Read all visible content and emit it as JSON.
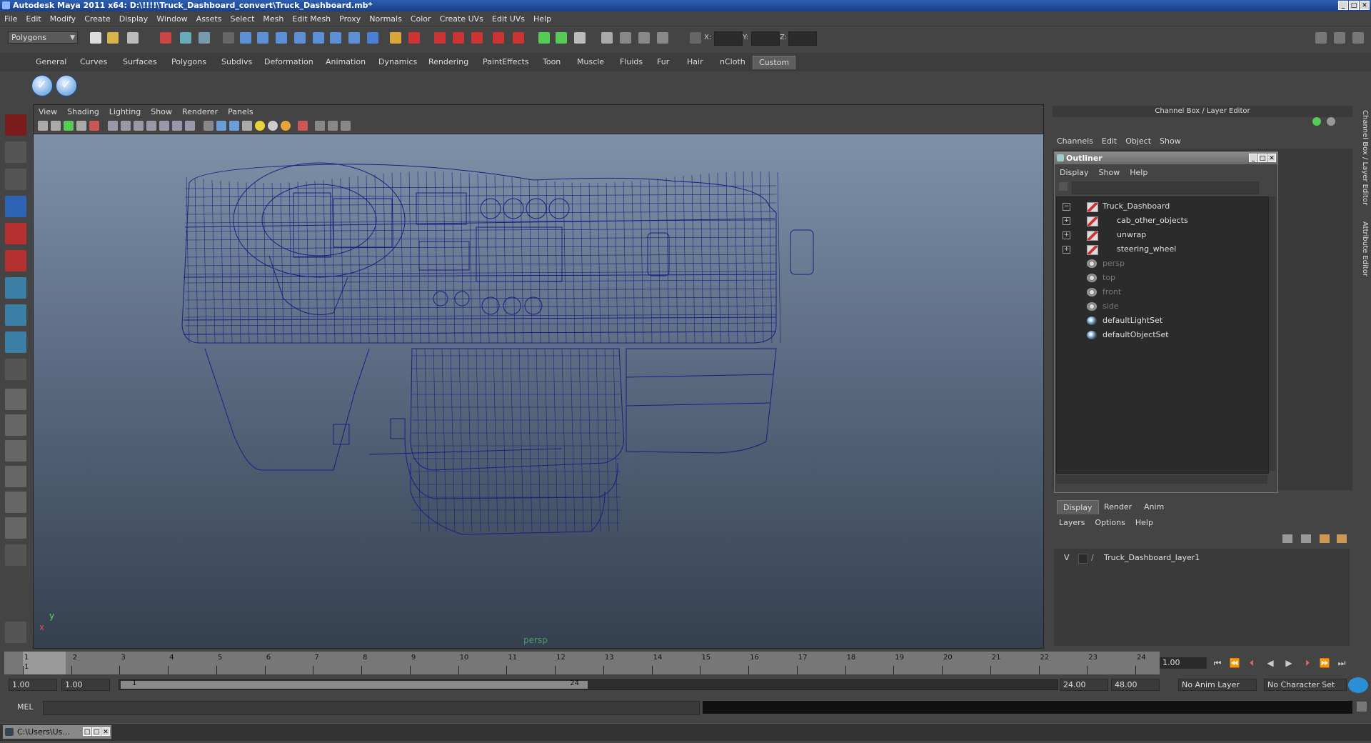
{
  "window": {
    "title": "Autodesk Maya 2011 x64: D:\\!!!!\\Truck_Dashboard_convert\\Truck_Dashboard.mb*"
  },
  "menubar": [
    "File",
    "Edit",
    "Modify",
    "Create",
    "Display",
    "Window",
    "Assets",
    "Select",
    "Mesh",
    "Edit Mesh",
    "Proxy",
    "Normals",
    "Color",
    "Create UVs",
    "Edit UVs",
    "Help"
  ],
  "status_line": {
    "mode": "Polygons",
    "x_label": "X:",
    "y_label": "Y:",
    "z_label": "Z:"
  },
  "shelf": {
    "tabs": [
      "General",
      "Curves",
      "Surfaces",
      "Polygons",
      "Subdivs",
      "Deformation",
      "Animation",
      "Dynamics",
      "Rendering",
      "PaintEffects",
      "Toon",
      "Muscle",
      "Fluids",
      "Fur",
      "Hair",
      "nCloth",
      "Custom"
    ],
    "active_tab": "Custom"
  },
  "viewport": {
    "menu": [
      "View",
      "Shading",
      "Lighting",
      "Show",
      "Renderer",
      "Panels"
    ],
    "camera_label": "persp",
    "axis_x": "x",
    "axis_y": "y",
    "wire_color": "#1a1f80"
  },
  "channel_box": {
    "title": "Channel Box / Layer Editor",
    "menu": [
      "Channels",
      "Edit",
      "Object",
      "Show"
    ]
  },
  "side_tabs": {
    "channel": "Channel Box / Layer Editor",
    "attribute": "Attribute Editor"
  },
  "outliner": {
    "title": "Outliner",
    "menu": [
      "Display",
      "Show",
      "Help"
    ],
    "items": [
      {
        "label": "Truck_Dashboard",
        "icon": "mesh-icon",
        "expander": "−",
        "dim": false
      },
      {
        "label": "cab_other_objects",
        "icon": "mesh-icon",
        "expander": "+",
        "dim": false
      },
      {
        "label": "unwrap",
        "icon": "mesh-icon",
        "expander": "+",
        "dim": false
      },
      {
        "label": "steering_wheel",
        "icon": "mesh-icon",
        "expander": "+",
        "dim": false
      },
      {
        "label": "persp",
        "icon": "camera-icon",
        "expander": "",
        "dim": true
      },
      {
        "label": "top",
        "icon": "camera-icon",
        "expander": "",
        "dim": true
      },
      {
        "label": "front",
        "icon": "camera-icon",
        "expander": "",
        "dim": true
      },
      {
        "label": "side",
        "icon": "camera-icon",
        "expander": "",
        "dim": true
      },
      {
        "label": "defaultLightSet",
        "icon": "set-icon",
        "expander": "",
        "dim": false
      },
      {
        "label": "defaultObjectSet",
        "icon": "set-icon",
        "expander": "",
        "dim": false
      }
    ]
  },
  "layer_editor": {
    "tabs": [
      "Display",
      "Render",
      "Anim"
    ],
    "active_tab": "Display",
    "menu": [
      "Layers",
      "Options",
      "Help"
    ],
    "layers": [
      {
        "visible": "V",
        "name": "Truck_Dashboard_layer1"
      }
    ]
  },
  "timeline": {
    "ticks": [
      "1",
      "2",
      "3",
      "4",
      "5",
      "6",
      "7",
      "8",
      "9",
      "10",
      "11",
      "12",
      "13",
      "14",
      "15",
      "16",
      "17",
      "18",
      "19",
      "20",
      "21",
      "22",
      "23",
      "24"
    ],
    "current_frame_label": "1",
    "current_frame": "1.00"
  },
  "range": {
    "start": "1.00",
    "playback_start": "1.00",
    "slider_start": "1",
    "slider_end": "24",
    "playback_end": "24.00",
    "end": "48.00",
    "anim_layer": "No Anim Layer",
    "character_set": "No Character Set"
  },
  "command_line": {
    "label": "MEL"
  },
  "taskbar": {
    "item": "C:\\Users\\Us..."
  }
}
